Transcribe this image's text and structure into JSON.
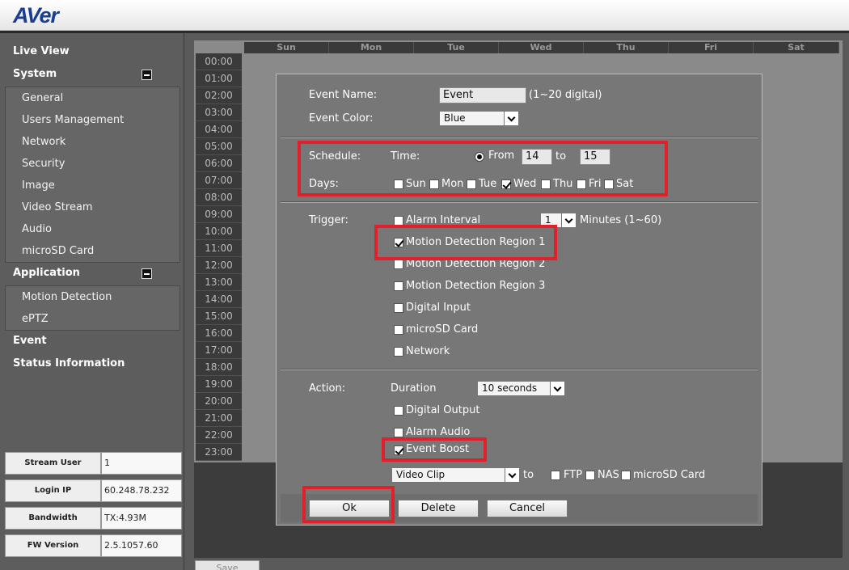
{
  "header": {
    "logo": "AVer"
  },
  "sidebar": {
    "live_view": "Live View",
    "system": "System",
    "system_items": [
      "General",
      "Users Management",
      "Network",
      "Security",
      "Image",
      "Video Stream",
      "Audio",
      "microSD Card"
    ],
    "application": "Application",
    "application_items": [
      "Motion Detection",
      "ePTZ"
    ],
    "event": "Event",
    "status_information": "Status Information"
  },
  "info": [
    {
      "label": "Stream User",
      "value": "1"
    },
    {
      "label": "Login IP",
      "value": "60.248.78.232"
    },
    {
      "label": "Bandwidth",
      "value": "TX:4.93M"
    },
    {
      "label": "FW Version",
      "value": "2.5.1057.60"
    }
  ],
  "schedule_grid": {
    "days": [
      "Sun",
      "Mon",
      "Tue",
      "Wed",
      "Thu",
      "Fri",
      "Sat"
    ],
    "hours": [
      "00:00",
      "01:00",
      "02:00",
      "03:00",
      "04:00",
      "05:00",
      "06:00",
      "07:00",
      "08:00",
      "09:00",
      "10:00",
      "11:00",
      "12:00",
      "13:00",
      "14:00",
      "15:00",
      "16:00",
      "17:00",
      "18:00",
      "19:00",
      "20:00",
      "21:00",
      "22:00",
      "23:00"
    ]
  },
  "save_label": "Save",
  "dialog": {
    "event_name_label": "Event Name:",
    "event_name_value": "Event",
    "event_name_hint": "(1~20 digital)",
    "event_color_label": "Event Color:",
    "event_color_value": "Blue",
    "schedule_label": "Schedule:",
    "time_label": "Time:",
    "from_label": "From",
    "from_value": "14",
    "to_label": "to",
    "to_value": "15",
    "days_label": "Days:",
    "days": [
      {
        "label": "Sun",
        "checked": false
      },
      {
        "label": "Mon",
        "checked": false
      },
      {
        "label": "Tue",
        "checked": false
      },
      {
        "label": "Wed",
        "checked": true
      },
      {
        "label": "Thu",
        "checked": false
      },
      {
        "label": "Fri",
        "checked": false
      },
      {
        "label": "Sat",
        "checked": false
      }
    ],
    "trigger_label": "Trigger:",
    "alarm_interval_label": "Alarm Interval",
    "alarm_interval_value": "1",
    "minutes_label": "Minutes (1~60)",
    "triggers": [
      {
        "label": "Motion Detection Region 1",
        "checked": true
      },
      {
        "label": "Motion Detection Region 2",
        "checked": false
      },
      {
        "label": "Motion Detection Region 3",
        "checked": false
      },
      {
        "label": "Digital Input",
        "checked": false
      },
      {
        "label": "microSD Card",
        "checked": false
      },
      {
        "label": "Network",
        "checked": false
      }
    ],
    "action_label": "Action:",
    "duration_label": "Duration",
    "duration_value": "10 seconds",
    "actions": [
      {
        "label": "Digital Output",
        "checked": false
      },
      {
        "label": "Alarm Audio",
        "checked": false
      },
      {
        "label": "Event Boost",
        "checked": true
      }
    ],
    "clip_value": "Video Clip",
    "clip_to_label": "to",
    "destinations": [
      {
        "label": "FTP",
        "checked": false
      },
      {
        "label": "NAS",
        "checked": false
      },
      {
        "label": "microSD Card",
        "checked": false
      }
    ],
    "ok_label": "Ok",
    "delete_label": "Delete",
    "cancel_label": "Cancel"
  },
  "colors": {
    "highlight": "#e0202a",
    "logo": "#1b3d8f"
  }
}
